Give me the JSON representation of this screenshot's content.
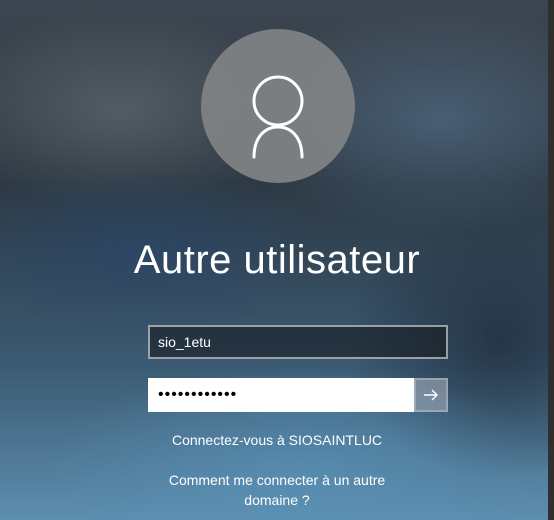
{
  "login": {
    "user_display_name": "Autre utilisateur",
    "username_value": "sio_1etu",
    "password_mask": "••••••••••••",
    "reveal_password_icon": "eye-icon",
    "submit_icon": "arrow-right-icon",
    "domain_prompt": "Connectez-vous à SIOSAINTLUC",
    "other_domain_help": "Comment me connecter à un autre domaine ?"
  },
  "colors": {
    "avatar_circle": "#818385",
    "field_background": "#14181c",
    "password_background": "#ffffff",
    "submit_background": "#8c9baa"
  }
}
